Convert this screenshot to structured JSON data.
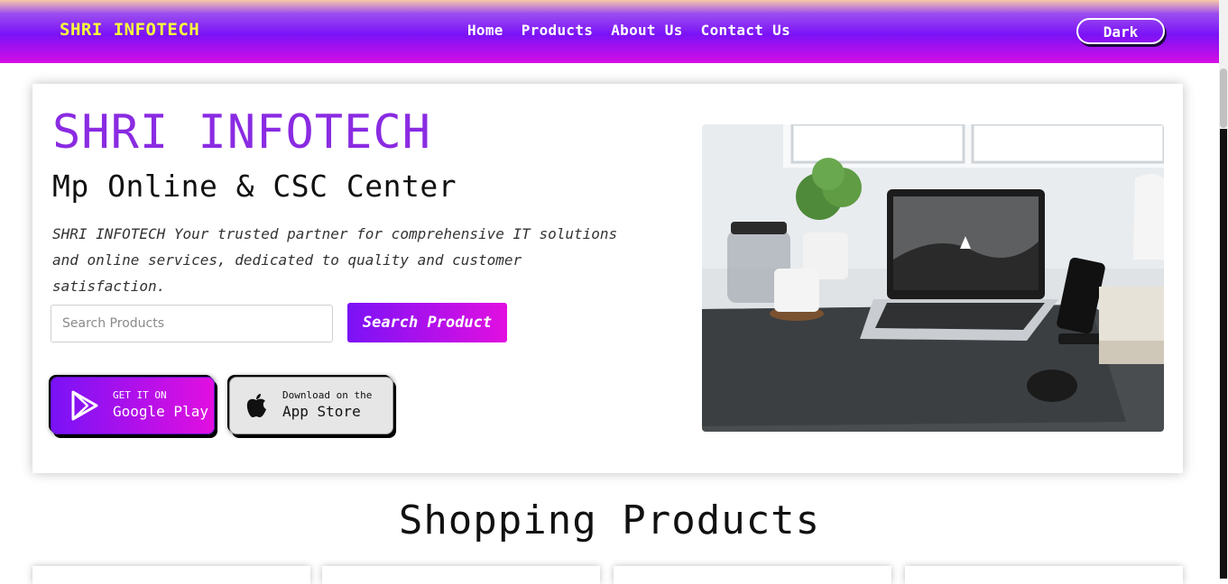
{
  "navbar": {
    "brand": "SHRI INFOTECH",
    "links": [
      "Home",
      "Products",
      "About Us",
      "Contact Us"
    ],
    "theme_toggle": "Dark"
  },
  "hero": {
    "title": "SHRI INFOTECH",
    "subtitle": "Mp Online & CSC Center",
    "description": "SHRI INFOTECH Your trusted partner for comprehensive IT solutions and online services, dedicated to quality and customer satisfaction.",
    "search": {
      "placeholder": "Search Products",
      "value": ""
    },
    "search_button": "Search Product",
    "google_play": {
      "small": "GET IT ON",
      "big": "Google Play"
    },
    "app_store": {
      "small": "Download on the",
      "big": "App Store"
    }
  },
  "products_section": {
    "title": "Shopping Products"
  },
  "colors": {
    "brand_yellow": "#f6ff3c",
    "accent_purple": "#8a2be2",
    "gradient_start": "#7a12f6",
    "gradient_end": "#e20fe0"
  },
  "icons": [
    "google-play-icon",
    "apple-icon"
  ]
}
